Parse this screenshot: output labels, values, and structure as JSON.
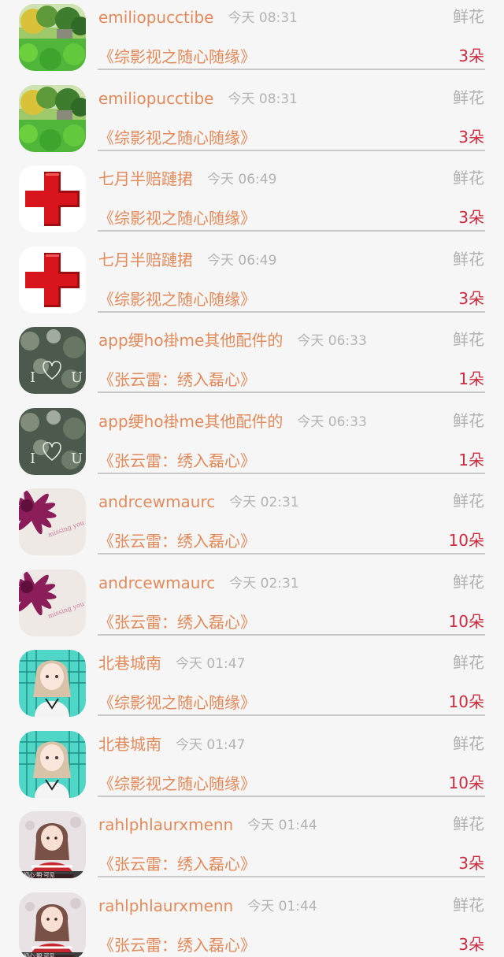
{
  "records": [
    {
      "name": "emiliopucctibe",
      "time": "今天 08:31",
      "type": "鲜花",
      "title": "《综影视之随心随缘》",
      "count": "3朵",
      "avatar": "landscape-avatar"
    },
    {
      "name": "emiliopucctibe",
      "time": "今天 08:31",
      "type": "鲜花",
      "title": "《综影视之随心随缘》",
      "count": "3朵",
      "avatar": "landscape-avatar"
    },
    {
      "name": "七月半赔蹥捃",
      "time": "今天 06:49",
      "type": "鲜花",
      "title": "《综影视之随心随缘》",
      "count": "3朵",
      "avatar": "red-cross-avatar"
    },
    {
      "name": "七月半赔蹥捃",
      "time": "今天 06:49",
      "type": "鲜花",
      "title": "《综影视之随心随缘》",
      "count": "3朵",
      "avatar": "red-cross-avatar"
    },
    {
      "name": "app绠ho褂me其他配件的",
      "time": "今天 06:33",
      "type": "鲜花",
      "title": "《张云雷：绣入磊心》",
      "count": "1朵",
      "avatar": "bokeh-heart-avatar"
    },
    {
      "name": "app绠ho褂me其他配件的",
      "time": "今天 06:33",
      "type": "鲜花",
      "title": "《张云雷：绣入磊心》",
      "count": "1朵",
      "avatar": "bokeh-heart-avatar"
    },
    {
      "name": "andrcewmaurc",
      "time": "今天 02:31",
      "type": "鲜花",
      "title": "《张云雷：绣入磊心》",
      "count": "10朵",
      "avatar": "purple-flower-avatar"
    },
    {
      "name": "andrcewmaurc",
      "time": "今天 02:31",
      "type": "鲜花",
      "title": "《张云雷：绣入磊心》",
      "count": "10朵",
      "avatar": "purple-flower-avatar"
    },
    {
      "name": "北巷城南",
      "time": "今天 01:47",
      "type": "鲜花",
      "title": "《综影视之随心随缘》",
      "count": "10朵",
      "avatar": "anime-girl-avatar"
    },
    {
      "name": "北巷城南",
      "time": "今天 01:47",
      "type": "鲜花",
      "title": "《综影视之随心随缘》",
      "count": "10朵",
      "avatar": "anime-girl-avatar"
    },
    {
      "name": "rahlphlaurxmenn",
      "time": "今天 01:44",
      "type": "鲜花",
      "title": "《张云雷：绣入磊心》",
      "count": "3朵",
      "avatar": "girl-red-sweater-avatar"
    },
    {
      "name": "rahlphlaurxmenn",
      "time": "今天 01:44",
      "type": "鲜花",
      "title": "《张云雷：绣入磊心》",
      "count": "3朵",
      "avatar": "girl-red-sweater-avatar"
    }
  ],
  "colors": {
    "background": "#f6f6f6",
    "name": "#e38a5b",
    "time": "#b3b3b3",
    "count": "#cc2a3d",
    "divider": "#c9c9c9"
  }
}
